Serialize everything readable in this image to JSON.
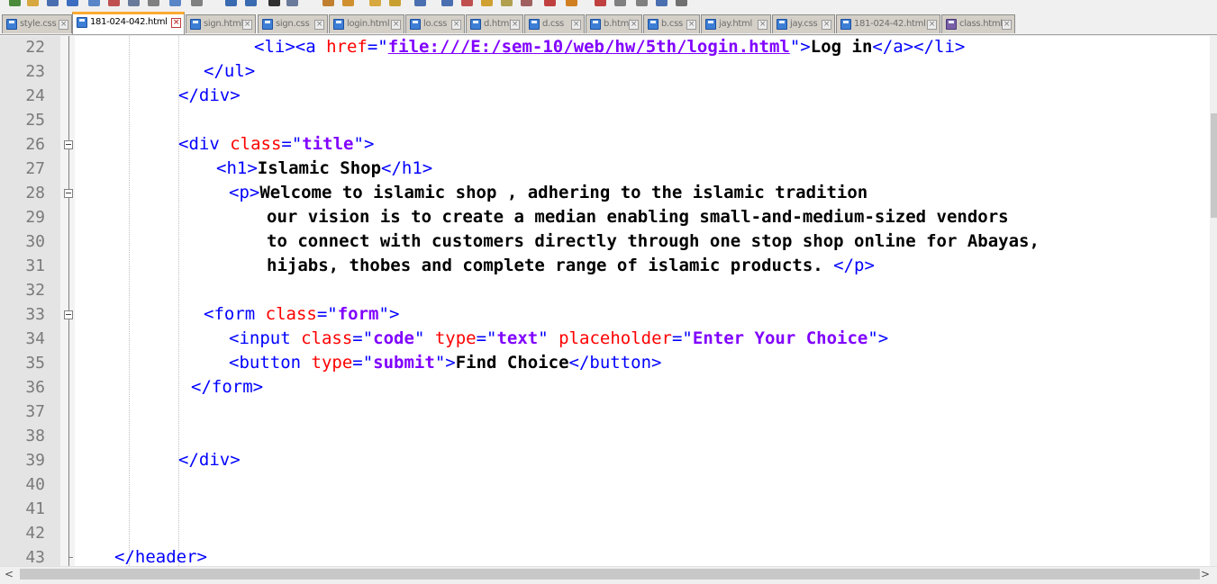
{
  "tabs": [
    {
      "label": "style.css",
      "saved": false,
      "active": false
    },
    {
      "label": "181-024-042.html",
      "saved": false,
      "active": true
    },
    {
      "label": "sign.html",
      "saved": false,
      "active": false
    },
    {
      "label": "sign.css",
      "saved": false,
      "active": false
    },
    {
      "label": "login.html",
      "saved": false,
      "active": false
    },
    {
      "label": "lo.css",
      "saved": false,
      "active": false
    },
    {
      "label": "d.html",
      "saved": false,
      "active": false
    },
    {
      "label": "d.css",
      "saved": false,
      "active": false
    },
    {
      "label": "b.html",
      "saved": false,
      "active": false
    },
    {
      "label": "b.css",
      "saved": false,
      "active": false
    },
    {
      "label": "jay.html",
      "saved": false,
      "active": false
    },
    {
      "label": "jay.css",
      "saved": false,
      "active": false
    },
    {
      "label": "181-024-42.html",
      "saved": false,
      "active": false
    },
    {
      "label": "class.html",
      "saved": true,
      "active": false
    }
  ],
  "tab_close_glyph": "×",
  "colors": {
    "tag": "#0000ff",
    "attribute": "#ff0000",
    "string": "#8000ff",
    "text": "#000000",
    "active_tab_accent": "#fbaa2f",
    "gutter": "#e4e4e4"
  },
  "editor": {
    "lines": [
      {
        "num": "22",
        "fold": "none",
        "tokens": [
          [
            "tg",
            "<li><a "
          ],
          [
            "at",
            "href"
          ],
          [
            "tg",
            "=\""
          ],
          [
            "sv ln",
            "file:///E:/sem-10/web/hw/5th/login.html"
          ],
          [
            "tg",
            "\">"
          ],
          [
            "tx",
            "Log in"
          ],
          [
            "tg",
            "</a></li>"
          ]
        ]
      },
      {
        "num": "23",
        "fold": "none",
        "tokens": [
          [
            "tg",
            "</ul>"
          ]
        ]
      },
      {
        "num": "24",
        "fold": "none",
        "tokens": [
          [
            "tg",
            "</div>"
          ]
        ]
      },
      {
        "num": "25",
        "fold": "none",
        "tokens": []
      },
      {
        "num": "26",
        "fold": "box",
        "tokens": [
          [
            "tg",
            "<div "
          ],
          [
            "at",
            "class"
          ],
          [
            "tg",
            "=\""
          ],
          [
            "sv",
            "title"
          ],
          [
            "tg",
            "\">"
          ]
        ]
      },
      {
        "num": "27",
        "fold": "none",
        "tokens": [
          [
            "tg",
            "<h1>"
          ],
          [
            "tx",
            "Islamic Shop"
          ],
          [
            "tg",
            "</h1>"
          ]
        ]
      },
      {
        "num": "28",
        "fold": "box",
        "tokens": [
          [
            "tg",
            "<p>"
          ],
          [
            "tx",
            "Welcome to islamic shop , adhering to the islamic tradition"
          ]
        ]
      },
      {
        "num": "29",
        "fold": "none",
        "tokens": [
          [
            "tx",
            "our vision is to create a median enabling small-and-medium-sized vendors"
          ]
        ]
      },
      {
        "num": "30",
        "fold": "none",
        "tokens": [
          [
            "tx",
            "to connect with customers directly through one stop shop online for Abayas,"
          ]
        ]
      },
      {
        "num": "31",
        "fold": "none",
        "tokens": [
          [
            "tx",
            "hijabs, thobes and complete range of islamic products. "
          ],
          [
            "tg",
            "</p>"
          ]
        ]
      },
      {
        "num": "32",
        "fold": "none",
        "tokens": []
      },
      {
        "num": "33",
        "fold": "box",
        "tokens": [
          [
            "tg",
            "<form "
          ],
          [
            "at",
            "class"
          ],
          [
            "tg",
            "=\""
          ],
          [
            "sv",
            "form"
          ],
          [
            "tg",
            "\">"
          ]
        ]
      },
      {
        "num": "34",
        "fold": "none",
        "tokens": [
          [
            "tg",
            "<input "
          ],
          [
            "at",
            "class"
          ],
          [
            "tg",
            "=\""
          ],
          [
            "sv",
            "code"
          ],
          [
            "tg",
            "\" "
          ],
          [
            "at",
            "type"
          ],
          [
            "tg",
            "=\""
          ],
          [
            "sv",
            "text"
          ],
          [
            "tg",
            "\" "
          ],
          [
            "at",
            "placeholder"
          ],
          [
            "tg",
            "=\""
          ],
          [
            "sv",
            "Enter Your Choice"
          ],
          [
            "tg",
            "\">"
          ]
        ]
      },
      {
        "num": "35",
        "fold": "none",
        "tokens": [
          [
            "tg",
            "<button "
          ],
          [
            "at",
            "type"
          ],
          [
            "tg",
            "=\""
          ],
          [
            "sv",
            "submit"
          ],
          [
            "tg",
            "\">"
          ],
          [
            "tx",
            "Find Choice"
          ],
          [
            "tg",
            "</button>"
          ]
        ]
      },
      {
        "num": "36",
        "fold": "none",
        "tokens": [
          [
            "tg",
            "</form>"
          ]
        ]
      },
      {
        "num": "37",
        "fold": "none",
        "tokens": []
      },
      {
        "num": "38",
        "fold": "none",
        "tokens": []
      },
      {
        "num": "39",
        "fold": "none",
        "tokens": [
          [
            "tg",
            "</div>"
          ]
        ]
      },
      {
        "num": "40",
        "fold": "none",
        "tokens": []
      },
      {
        "num": "41",
        "fold": "none",
        "tokens": []
      },
      {
        "num": "42",
        "fold": "none",
        "tokens": []
      },
      {
        "num": "43",
        "fold": "none",
        "tokens": [
          [
            "tg",
            "</header>"
          ]
        ]
      }
    ]
  },
  "scrollbar": {
    "left_arrow": "<",
    "right_arrow": ">"
  }
}
